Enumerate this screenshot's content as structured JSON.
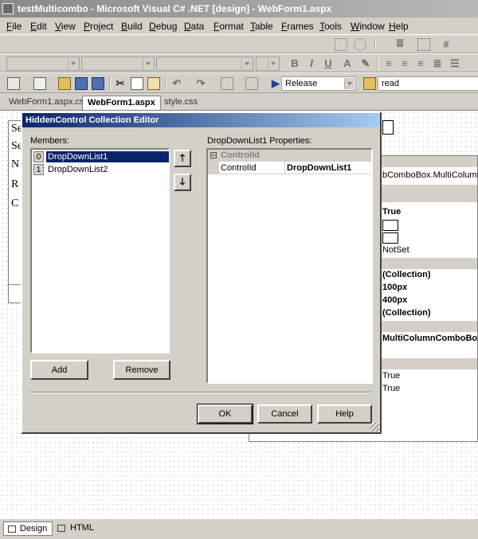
{
  "window": {
    "title": "testMulticombo - Microsoft Visual C# .NET [design] - WebForm1.aspx"
  },
  "menu": [
    "File",
    "Edit",
    "View",
    "Project",
    "Build",
    "Debug",
    "Data",
    "Format",
    "Table",
    "Frames",
    "Tools",
    "Window",
    "Help"
  ],
  "toolbar": {
    "config_value": "Release",
    "find_value": "read"
  },
  "doc_tabs": [
    "WebForm1.aspx.cs",
    "WebForm1.aspx",
    "style.css"
  ],
  "designer_left_labels": [
    "Se",
    "Se",
    "N",
    "R",
    "C"
  ],
  "background_props": {
    "type_text": "bComboBox.MultiColumnC",
    "values": [
      "True",
      "NotSet",
      "(Collection)",
      "100px",
      "400px",
      "(Collection)",
      "MultiColumnComboBox",
      "True",
      "True"
    ]
  },
  "dialog": {
    "title": "HiddenControl Collection Editor",
    "members_label": "Members:",
    "members": [
      {
        "index": "0",
        "name": "DropDownList1"
      },
      {
        "index": "1",
        "name": "DropDownList2"
      }
    ],
    "up_glyph": "🡑",
    "down_glyph": "🡓",
    "props_label": "DropDownList1 Properties:",
    "category": "ControlId",
    "category_toggle": "⊟",
    "prop_name": "ControlId",
    "prop_value": "DropDownList1",
    "add_label": "Add",
    "remove_label": "Remove",
    "ok_label": "OK",
    "cancel_label": "Cancel",
    "help_label": "Help"
  },
  "view_tabs": [
    "Design",
    "HTML"
  ],
  "colors": {
    "selection": "#0a246a",
    "dialog_face": "#d4d0c8"
  }
}
